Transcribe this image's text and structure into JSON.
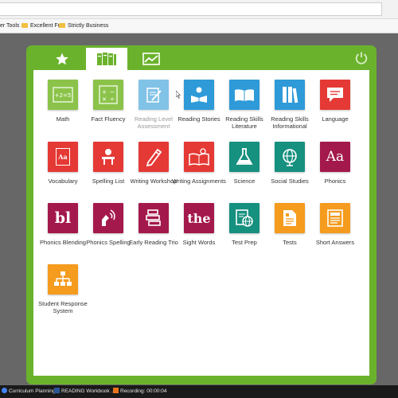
{
  "browser": {
    "bookmarks": [
      "er Tools",
      "Excellent Fun",
      "Strictly Business"
    ]
  },
  "colors": {
    "frame_green": "#6bb22c",
    "lime": "#8bc34a",
    "blue": "#2e9ad8",
    "red": "#e53935",
    "teal": "#16907f",
    "maroon": "#a4194c",
    "orange": "#f59b1d"
  },
  "tabs": [
    {
      "name": "favorites",
      "icon": "star-icon"
    },
    {
      "name": "library",
      "icon": "books-icon",
      "active": true
    },
    {
      "name": "reports",
      "icon": "line-chart-icon"
    }
  ],
  "tiles": [
    {
      "label": "Math",
      "icon": "math-board-icon",
      "color": "#8bc34a"
    },
    {
      "label": "Fact Fluency",
      "icon": "calculator-icon",
      "color": "#8bc34a"
    },
    {
      "label": "Reading Level Assessment",
      "icon": "clipboard-icon",
      "color": "#2e9ad8",
      "dim": true
    },
    {
      "label": "Reading Stories",
      "icon": "reader-icon",
      "color": "#2e9ad8"
    },
    {
      "label": "Reading Skills Literature",
      "icon": "open-book-icon",
      "color": "#2e9ad8"
    },
    {
      "label": "Reading Skills Informational",
      "icon": "book-stack-icon",
      "color": "#2e9ad8"
    },
    {
      "label": "Language",
      "icon": "speech-bubble-icon",
      "color": "#e53935"
    },
    {
      "label": "Vocabulary",
      "icon": "dictionary-icon",
      "color": "#e53935"
    },
    {
      "label": "Spelling List",
      "icon": "student-desk-icon",
      "color": "#e53935"
    },
    {
      "label": "Writing Workshop",
      "icon": "pencil-icon",
      "color": "#e53935"
    },
    {
      "label": "Writing Assignments",
      "icon": "idea-book-icon",
      "color": "#e53935"
    },
    {
      "label": "Science",
      "icon": "flask-icon",
      "color": "#16907f"
    },
    {
      "label": "Social Studies",
      "icon": "globe-icon",
      "color": "#16907f"
    },
    {
      "label": "Phonics",
      "icon": "aa-icon",
      "color": "#a4194c"
    },
    {
      "label": "Phonics Blending",
      "icon": "bl-icon",
      "color": "#a4194c"
    },
    {
      "label": "Phonics Spelling",
      "icon": "sound-hand-icon",
      "color": "#a4194c"
    },
    {
      "label": "Early Reading Trio",
      "icon": "stacked-blocks-icon",
      "color": "#a4194c"
    },
    {
      "label": "Sight Words",
      "icon": "the-icon",
      "color": "#a4194c"
    },
    {
      "label": "Test Prep",
      "icon": "test-sheet-globe-icon",
      "color": "#16907f"
    },
    {
      "label": "Tests",
      "icon": "test-document-icon",
      "color": "#f59b1d"
    },
    {
      "label": "Short Answers",
      "icon": "answer-sheet-icon",
      "color": "#f59b1d"
    },
    {
      "label": "Student Response System",
      "icon": "network-icon",
      "color": "#f59b1d"
    }
  ],
  "icon_text": {
    "vocabulary": "Aa",
    "phonics": "Aa",
    "phonics_blending": "bl",
    "sight_words": "the"
  },
  "taskbar": [
    {
      "label": "Curriculum Planning",
      "icon": "chrome-icon"
    },
    {
      "label": "READING Workbook ...",
      "icon": "word-icon"
    },
    {
      "label": "Recording: 00:00:04",
      "icon": "record-icon"
    }
  ]
}
